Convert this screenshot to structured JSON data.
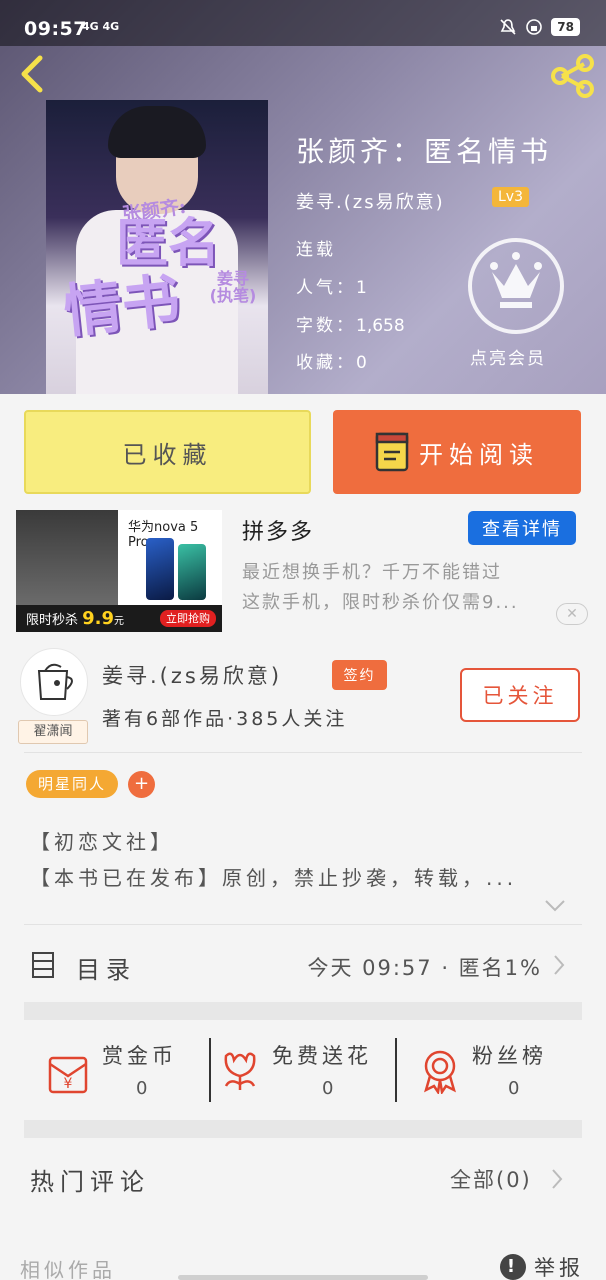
{
  "status_bar": {
    "time": "09:57",
    "network": "4G 4G",
    "hd": "HD",
    "battery": "78"
  },
  "book": {
    "title": "张颜齐：匿名情书",
    "author_display": "姜寻.(zs易欣意)",
    "author_level": "Lv3",
    "status": "连载",
    "popularity_label": "人气：",
    "popularity": "1",
    "word_count_label": "字数：",
    "word_count": "1,658",
    "favorites_label": "收藏：",
    "favorites": "0",
    "cover": {
      "title_small": "张颜齐:",
      "title_big_1": "匿名",
      "title_big_2": "情书",
      "author_tag": "姜寻(执笔)"
    }
  },
  "vip": {
    "label": "点亮会员"
  },
  "actions": {
    "favorited_label": "已收藏",
    "read_label": "开始阅读"
  },
  "ad": {
    "phone_title": "华为nova 5 Pro",
    "banner_text": "限时秒杀",
    "banner_price": "9.9",
    "banner_unit": "元",
    "banner_cta": "立即抢购",
    "name": "拼多多",
    "detail_button": "查看详情",
    "desc_line1": "最近想换手机？千万不能错过",
    "desc_line2": "这款手机，限时秒杀价仅需9..."
  },
  "author": {
    "name": "姜寻.(zs易欣意)",
    "signed_badge": "签约",
    "stats": "著有6部作品·385人关注",
    "follow_label": "已关注",
    "avatar_tag": "翟潇闻"
  },
  "tags": {
    "items": [
      "明星同人"
    ],
    "add_symbol": "+"
  },
  "intro": {
    "line1": "【初恋文社】",
    "line2": "【本书已在发布】原创，禁止抄袭，转载，..."
  },
  "catalog": {
    "label": "目录",
    "latest": "今天 09:57 · 匿名1%"
  },
  "rewards": {
    "coin_label": "赏金币",
    "coin_count": "0",
    "flower_label": "免费送花",
    "flower_count": "0",
    "fans_label": "粉丝榜",
    "fans_count": "0"
  },
  "comments": {
    "title": "热门评论",
    "all_label": "全部(0)"
  },
  "footer": {
    "similar_label": "相似作品",
    "report_label": "举报",
    "report_icon_glyph": "!"
  },
  "colors": {
    "accent_orange": "#ef6d3e",
    "favorite_yellow": "#f8ed7f",
    "tag_orange": "#f4a833",
    "ad_blue": "#1a6fe0",
    "reward_red": "#e0452f"
  }
}
